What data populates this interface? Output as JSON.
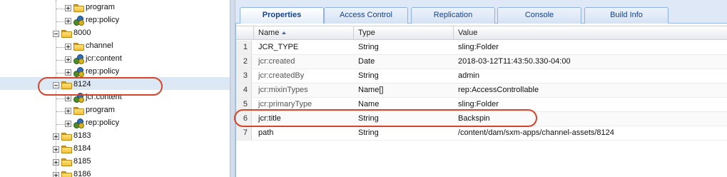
{
  "tree": {
    "nodes": [
      {
        "label": "program",
        "icon": "folder-icon",
        "toggle": "plus"
      },
      {
        "label": "rep:policy",
        "icon": "node-icon",
        "toggle": "plus"
      },
      {
        "label": "8000",
        "icon": "folder-icon",
        "toggle": "minus"
      },
      {
        "label": "channel",
        "icon": "folder-icon",
        "toggle": "plus"
      },
      {
        "label": "jcr:content",
        "icon": "node-icon",
        "toggle": "plus"
      },
      {
        "label": "rep:policy",
        "icon": "node-icon",
        "toggle": "plus"
      },
      {
        "label": "8124",
        "icon": "folder-icon",
        "toggle": "minus",
        "selected": true
      },
      {
        "label": "jcr:content",
        "icon": "node-icon",
        "toggle": "plus"
      },
      {
        "label": "program",
        "icon": "folder-icon",
        "toggle": "plus"
      },
      {
        "label": "rep:policy",
        "icon": "node-icon",
        "toggle": "plus"
      },
      {
        "label": "8183",
        "icon": "folder-icon",
        "toggle": "plus"
      },
      {
        "label": "8184",
        "icon": "folder-icon",
        "toggle": "plus"
      },
      {
        "label": "8185",
        "icon": "folder-icon",
        "toggle": "plus"
      },
      {
        "label": "8186",
        "icon": "folder-icon",
        "toggle": "plus"
      }
    ]
  },
  "tabs": [
    {
      "label": "Properties",
      "active": true
    },
    {
      "label": "Access Control",
      "active": false
    },
    {
      "label": "Replication",
      "active": false
    },
    {
      "label": "Console",
      "active": false
    },
    {
      "label": "Build Info",
      "active": false
    }
  ],
  "grid": {
    "columns": {
      "name": "Name",
      "type": "Type",
      "value": "Value"
    },
    "sort_column": "Name",
    "sort_direction": "ascending",
    "rows": [
      {
        "num": "1",
        "name": "JCR_TYPE",
        "type": "String",
        "value": "sling:Folder",
        "dim": false
      },
      {
        "num": "2",
        "name": "jcr:created",
        "type": "Date",
        "value": "2018-03-12T11:43:50.330-04:00",
        "dim": true
      },
      {
        "num": "3",
        "name": "jcr:createdBy",
        "type": "String",
        "value": "admin",
        "dim": true
      },
      {
        "num": "4",
        "name": "jcr:mixinTypes",
        "type": "Name[]",
        "value": "rep:AccessControllable",
        "dim": true
      },
      {
        "num": "5",
        "name": "jcr:primaryType",
        "type": "Name",
        "value": "sling:Folder",
        "dim": true
      },
      {
        "num": "6",
        "name": "jcr:title",
        "type": "String",
        "value": "Backspin",
        "dim": false
      },
      {
        "num": "7",
        "name": "path",
        "type": "String",
        "value": "/content/dam/sxm-apps/channel-assets/8124",
        "dim": false
      }
    ]
  },
  "colors": {
    "annotation": "#d6452b",
    "tab_text": "#15428b",
    "selection": "#dde8f5"
  }
}
